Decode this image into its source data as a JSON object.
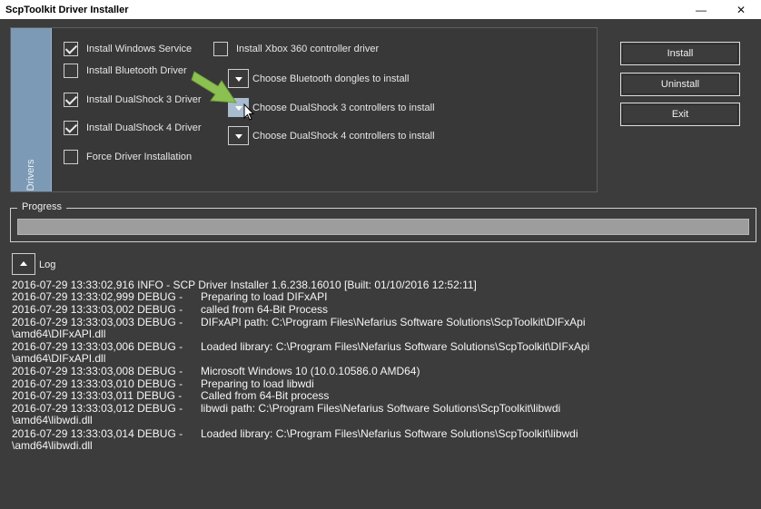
{
  "window": {
    "title": "ScpToolkit Driver Installer",
    "minimize_glyph": "—",
    "close_glyph": "✕"
  },
  "drivers": {
    "tab_label": "Drivers",
    "options": [
      {
        "label": "Install Windows Service",
        "checked": true
      },
      {
        "label": "Install Bluetooth Driver",
        "checked": false
      },
      {
        "label": "Install DualShock 3 Driver",
        "checked": true
      },
      {
        "label": "Install DualShock 4 Driver",
        "checked": true
      },
      {
        "label": "Force Driver Installation",
        "checked": false
      }
    ],
    "xbox_option": {
      "label": "Install Xbox 360 controller driver",
      "checked": false
    },
    "dropdowns": [
      {
        "label": "Choose Bluetooth dongles to install"
      },
      {
        "label": "Choose DualShock 3 controllers to install"
      },
      {
        "label": "Choose DualShock 4 controllers to install"
      }
    ]
  },
  "actions": {
    "install_label": "Install",
    "uninstall_label": "Uninstall",
    "exit_label": "Exit"
  },
  "progress": {
    "label": "Progress",
    "value_percent": 0
  },
  "log": {
    "label": "Log",
    "lines": [
      {
        "ts": "2016-07-29 13:33:02,916 INFO - SCP Driver Installer 1.6.238.16010 [Built: 01/10/2016 12:52:11]",
        "msg": ""
      },
      {
        "ts": "2016-07-29 13:33:02,999 DEBUG -",
        "msg": "Preparing to load DIFxAPI"
      },
      {
        "ts": "2016-07-29 13:33:03,002 DEBUG -",
        "msg": "called from 64-Bit Process"
      },
      {
        "ts": "2016-07-29 13:33:03,003 DEBUG -",
        "msg": "DIFxAPI path: C:\\Program Files\\Nefarius Software Solutions\\ScpToolkit\\DIFxApi"
      },
      {
        "ts": "\\amd64\\DIFxAPI.dll",
        "msg": ""
      },
      {
        "ts": "2016-07-29 13:33:03,006 DEBUG -",
        "msg": "Loaded library: C:\\Program Files\\Nefarius Software Solutions\\ScpToolkit\\DIFxApi"
      },
      {
        "ts": "\\amd64\\DIFxAPI.dll",
        "msg": ""
      },
      {
        "ts": "2016-07-29 13:33:03,008 DEBUG -",
        "msg": "Microsoft Windows 10 (10.0.10586.0 AMD64)"
      },
      {
        "ts": "2016-07-29 13:33:03,010 DEBUG -",
        "msg": "Preparing to load libwdi"
      },
      {
        "ts": "2016-07-29 13:33:03,011 DEBUG -",
        "msg": "Called from 64-Bit process"
      },
      {
        "ts": "2016-07-29 13:33:03,012 DEBUG -",
        "msg": "libwdi path: C:\\Program Files\\Nefarius Software Solutions\\ScpToolkit\\libwdi"
      },
      {
        "ts": "\\amd64\\libwdi.dll",
        "msg": ""
      },
      {
        "ts": "2016-07-29 13:33:03,014 DEBUG -",
        "msg": "Loaded library: C:\\Program Files\\Nefarius Software Solutions\\ScpToolkit\\libwdi"
      },
      {
        "ts": "\\amd64\\libwdi.dll",
        "msg": ""
      }
    ]
  },
  "colors": {
    "background": "#3c3c3c",
    "drivers_tab": "#7c9ab5",
    "annotation_arrow": "#8cc152"
  }
}
